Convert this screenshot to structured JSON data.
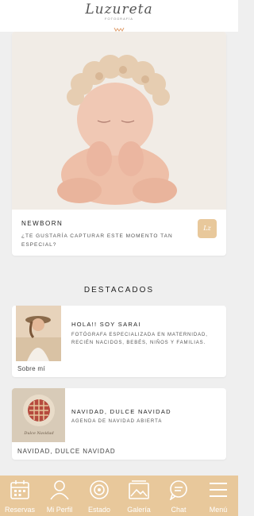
{
  "header": {
    "logo_script": "Luzureta",
    "logo_sub": "FOTOGRAFÍA"
  },
  "hero": {
    "title": "NEWBORN",
    "description": "¿TE GUSTARÍA CAPTURAR ESTE MOMENTO TAN ESPECIAL?",
    "badge_text": "Lz",
    "image_icon": "newborn-photo"
  },
  "featured": {
    "heading": "DESTACADOS",
    "items": [
      {
        "title": "HOLA!! SOY SARAI",
        "description": "FOTÓGRAFA ESPECIALIZADA EN MATERNIDAD, RECIÉN NACIDOS, BEBÉS, NIÑOS Y FAMILIAS.",
        "caption": "Sobre mí"
      },
      {
        "title": "NAVIDAD, DULCE NAVIDAD",
        "description": "AGENDA DE NAVIDAD ABIERTA",
        "caption": "NAVIDAD, DULCE NAVIDAD",
        "image_text": "Dulce Navidad"
      }
    ]
  },
  "tabbar": {
    "tabs": [
      {
        "label": "Reservas",
        "icon": "calendar-icon"
      },
      {
        "label": "Mi Perfil",
        "icon": "user-icon"
      },
      {
        "label": "Estado",
        "icon": "status-icon"
      },
      {
        "label": "Galería",
        "icon": "gallery-icon"
      },
      {
        "label": "Chat",
        "icon": "chat-icon"
      },
      {
        "label": "Menú",
        "icon": "menu-icon"
      }
    ]
  },
  "colors": {
    "accent": "#e8c89b",
    "background": "#efefef"
  }
}
